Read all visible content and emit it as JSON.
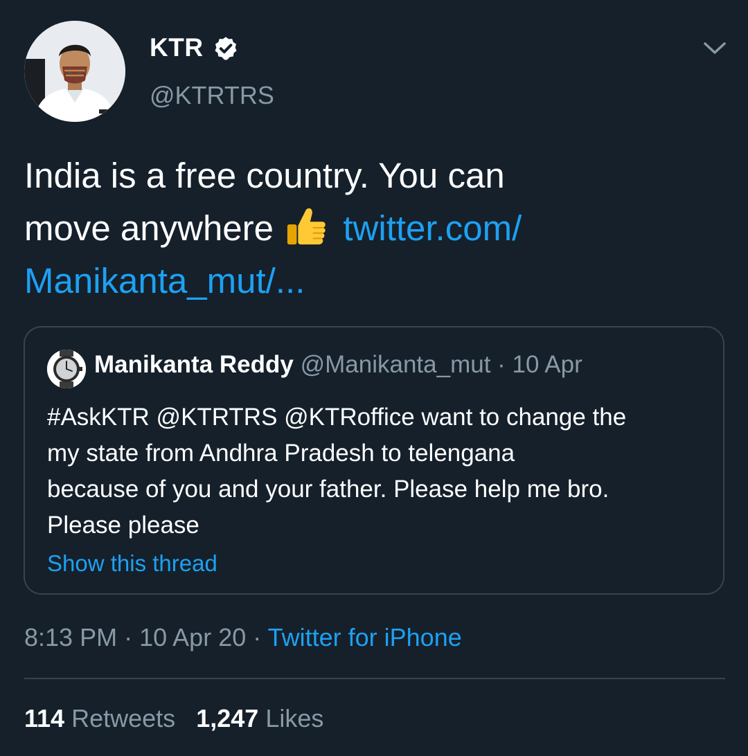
{
  "author": {
    "name": "KTR",
    "handle": "@KTRTRS",
    "verified": true
  },
  "tweet": {
    "text_line1": "India is a free country. You can",
    "text_line2_prefix": "move anywhere",
    "emoji": "thumbs-up-icon",
    "link_part1": "twitter.com/",
    "link_part2": "Manikanta_mut/..."
  },
  "quoted_tweet": {
    "name": "Manikanta Reddy",
    "handle": "@Manikanta_mut",
    "separator": "·",
    "date": "10 Apr",
    "lines": [
      "#AskKTR @KTRTRS @KTRoffice want to change the",
      "my state from Andhra Pradesh to telengana",
      "because of you and your father. Please help me bro.",
      "Please please"
    ],
    "show_thread": "Show this thread"
  },
  "meta": {
    "time": "8:13 PM",
    "separator": "·",
    "date": "10 Apr 20",
    "source": "Twitter for iPhone"
  },
  "stats": {
    "retweets_count": "114",
    "retweets_label": "Retweets",
    "likes_count": "1,247",
    "likes_label": "Likes"
  },
  "colors": {
    "background": "#15202b",
    "link": "#1da1f2",
    "secondary_text": "#8899a6",
    "border": "#38444d"
  }
}
